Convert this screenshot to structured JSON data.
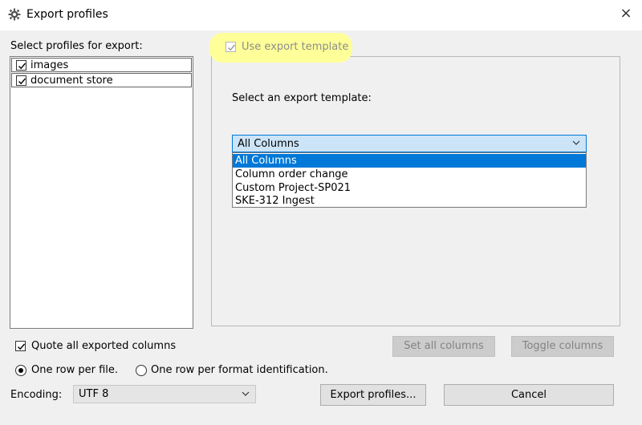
{
  "window": {
    "title": "Export profiles",
    "close_icon": "×"
  },
  "profiles": {
    "label": "Select profiles for export:",
    "items": [
      {
        "label": "images",
        "checked": true
      },
      {
        "label": "document store",
        "checked": true
      }
    ]
  },
  "template": {
    "use_label": "Use export template",
    "use_checked": true,
    "select_label": "Select an export template:",
    "selected": "All Columns",
    "options": [
      "All Columns",
      "Column order change",
      "Custom Project-SP021",
      "SKE-312 Ingest"
    ]
  },
  "options": {
    "quote_label": "Quote all exported columns",
    "quote_checked": true,
    "set_all_label": "Set all columns",
    "toggle_label": "Toggle columns",
    "radio_one_per_file": "One row per file.",
    "radio_one_per_format": "One row per format identification.",
    "selected_radio": "One row per file."
  },
  "encoding": {
    "label": "Encoding:",
    "value": "UTF 8"
  },
  "actions": {
    "export_label": "Export profiles...",
    "cancel_label": "Cancel"
  },
  "colors": {
    "accent": "#0078d7",
    "highlight": "#ffff99",
    "selection_bg": "#cce4f7"
  },
  "icons": {
    "app": "gear-icon",
    "close": "close-icon",
    "dropdown": "chevron-down-icon",
    "check": "checkmark-icon"
  }
}
